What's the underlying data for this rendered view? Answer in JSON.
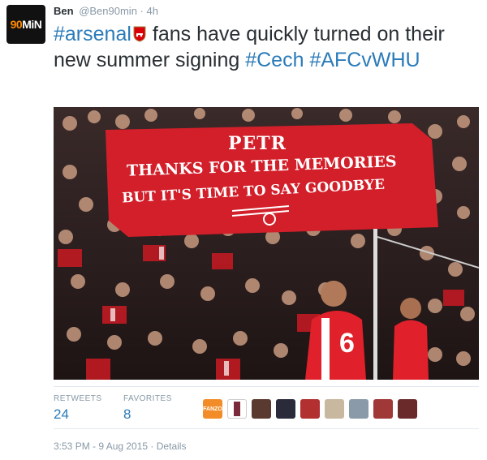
{
  "tweet": {
    "author_name": "Ben",
    "author_handle": "@Ben90min · 4h",
    "avatar_text_a": "90",
    "avatar_text_b": "MiN",
    "hashtag_arsenal": "#arsenal",
    "text_line1_rest": "fans have quickly turned on",
    "text_line2_plain": "their new summer signing",
    "hashtag_cech": "#Cech",
    "hashtag_match": "#AFCvWHU"
  },
  "photo": {
    "banner_line1": "PETR",
    "banner_line2": "THANKS FOR THE MEMORIES",
    "banner_line3": "BUT IT'S TIME TO SAY GOODBYE",
    "player_number": "6"
  },
  "stats": {
    "retweets_label": "RETWEETS",
    "retweets_value": "24",
    "favorites_label": "FAVORITES",
    "favorites_value": "8"
  },
  "favorite_avatars": {
    "first_label": "FANZO"
  },
  "meta": {
    "timestamp": "3:53 PM - 9 Aug 2015",
    "separator": " · ",
    "details_label": "Details"
  },
  "colors": {
    "link": "#2b7bb9",
    "muted": "#8899a6",
    "banner_red": "#d21f2a",
    "kit_red": "#e0202a"
  }
}
